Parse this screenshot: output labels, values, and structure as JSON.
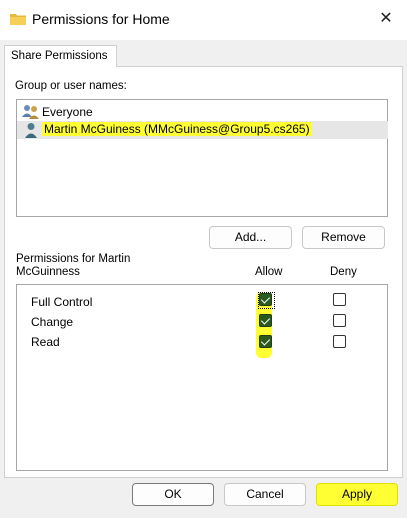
{
  "window": {
    "title": "Permissions for Home",
    "close_glyph": "✕",
    "folder_icon_color": "#e8b83a"
  },
  "tabs": [
    {
      "label": "Share Permissions",
      "active": true
    }
  ],
  "group_section": {
    "label": "Group or user names:",
    "items": [
      {
        "label": "Everyone",
        "icon": "users-group-icon",
        "selected": false
      },
      {
        "label": "Martin McGuiness (MMcGuiness@Group5.cs265)",
        "icon": "user-icon",
        "selected": true,
        "highlighted": true
      }
    ]
  },
  "buttons": {
    "add": "Add...",
    "remove": "Remove",
    "ok": "OK",
    "cancel": "Cancel",
    "apply": "Apply"
  },
  "permissions_section": {
    "label_line1": "Permissions for Martin",
    "label_line2": "McGuinness",
    "allow_header": "Allow",
    "deny_header": "Deny",
    "rows": [
      {
        "name": "Full Control",
        "allow": true,
        "deny": false
      },
      {
        "name": "Change",
        "allow": true,
        "deny": false
      },
      {
        "name": "Read",
        "allow": true,
        "deny": false
      }
    ]
  },
  "colors": {
    "highlight": "#ffff33",
    "check_fill": "#2b5a1e",
    "dialog_bg": "#f0f0f0"
  }
}
